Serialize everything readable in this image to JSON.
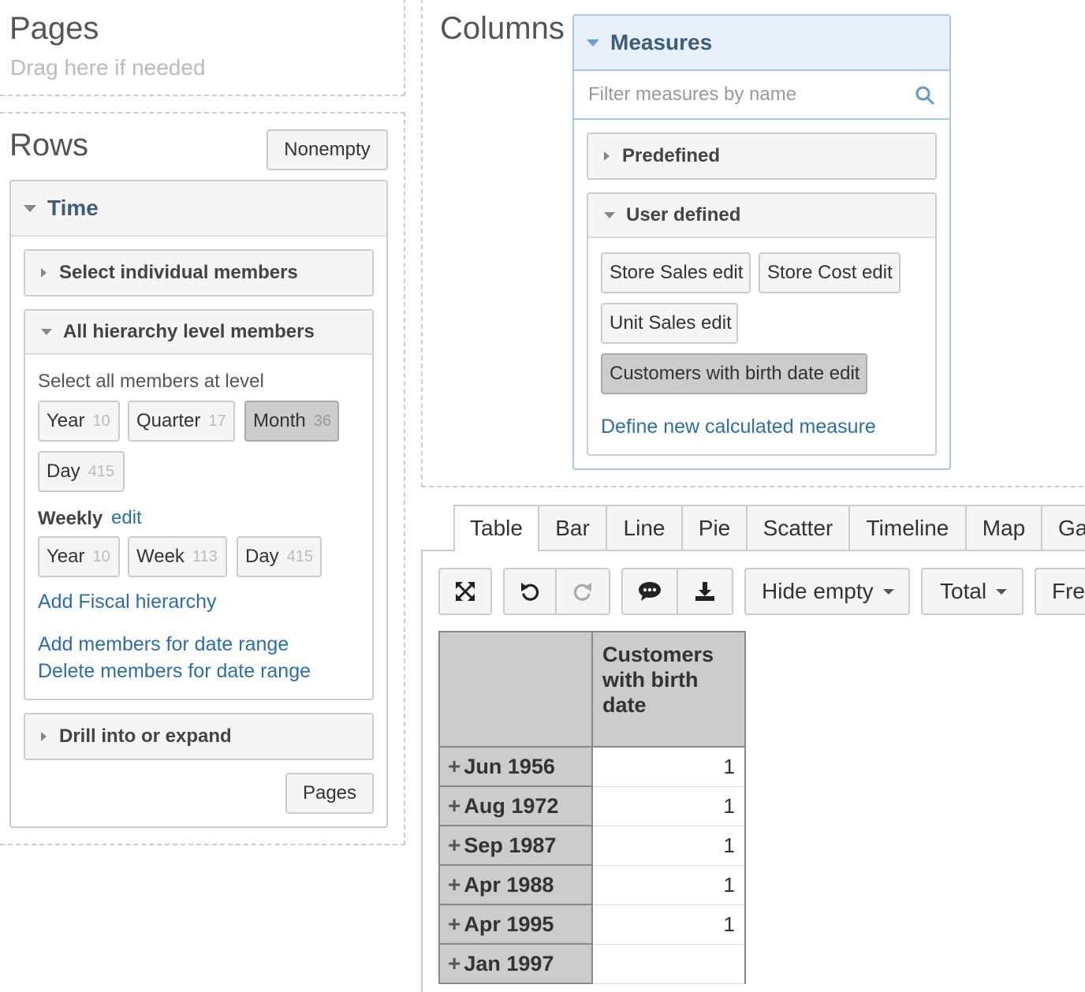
{
  "pages_zone": {
    "title": "Pages",
    "hint": "Drag here if needed"
  },
  "rows_zone": {
    "title": "Rows",
    "nonempty_label": "Nonempty",
    "time_panel": {
      "title": "Time",
      "select_individual": "Select individual members",
      "all_levels": {
        "title": "All hierarchy level members",
        "intro": "Select all members at level",
        "levels": [
          {
            "label": "Year",
            "count": "10"
          },
          {
            "label": "Quarter",
            "count": "17"
          },
          {
            "label": "Month",
            "count": "36",
            "selected": true
          },
          {
            "label": "Day",
            "count": "415"
          }
        ],
        "weekly_label": "Weekly",
        "weekly_edit": "edit",
        "weekly_levels": [
          {
            "label": "Year",
            "count": "10"
          },
          {
            "label": "Week",
            "count": "113"
          },
          {
            "label": "Day",
            "count": "415"
          }
        ],
        "add_fiscal": "Add Fiscal hierarchy",
        "add_range": "Add members for date range",
        "delete_range": "Delete members for date range"
      },
      "drill": "Drill into or expand",
      "pages_button": "Pages"
    }
  },
  "columns_zone": {
    "title": "Columns",
    "measures": {
      "title": "Measures",
      "filter_placeholder": "Filter measures by name",
      "predefined": "Predefined",
      "user_defined": "User defined",
      "items": [
        "Store Sales edit",
        "Store Cost edit",
        "Unit Sales edit",
        "Customers with birth date edit"
      ],
      "define_new": "Define new calculated measure"
    }
  },
  "chart_tabs": [
    "Table",
    "Bar",
    "Line",
    "Pie",
    "Scatter",
    "Timeline",
    "Map",
    "Ga"
  ],
  "toolbar": {
    "hide_empty": "Hide empty",
    "total": "Total",
    "fre": "Fre"
  },
  "table": {
    "measure_header": "Customers with birth date",
    "rows": [
      {
        "label": "Jun 1956",
        "value": "1"
      },
      {
        "label": "Aug 1972",
        "value": "1"
      },
      {
        "label": "Sep 1987",
        "value": "1"
      },
      {
        "label": "Apr 1988",
        "value": "1"
      },
      {
        "label": "Apr 1995",
        "value": "1"
      },
      {
        "label": "Jan 1997",
        "value": ""
      }
    ]
  },
  "colors": {
    "accent": "#3d5d80",
    "link": "#2a6eb0",
    "measures_border": "#a8c8e8"
  }
}
